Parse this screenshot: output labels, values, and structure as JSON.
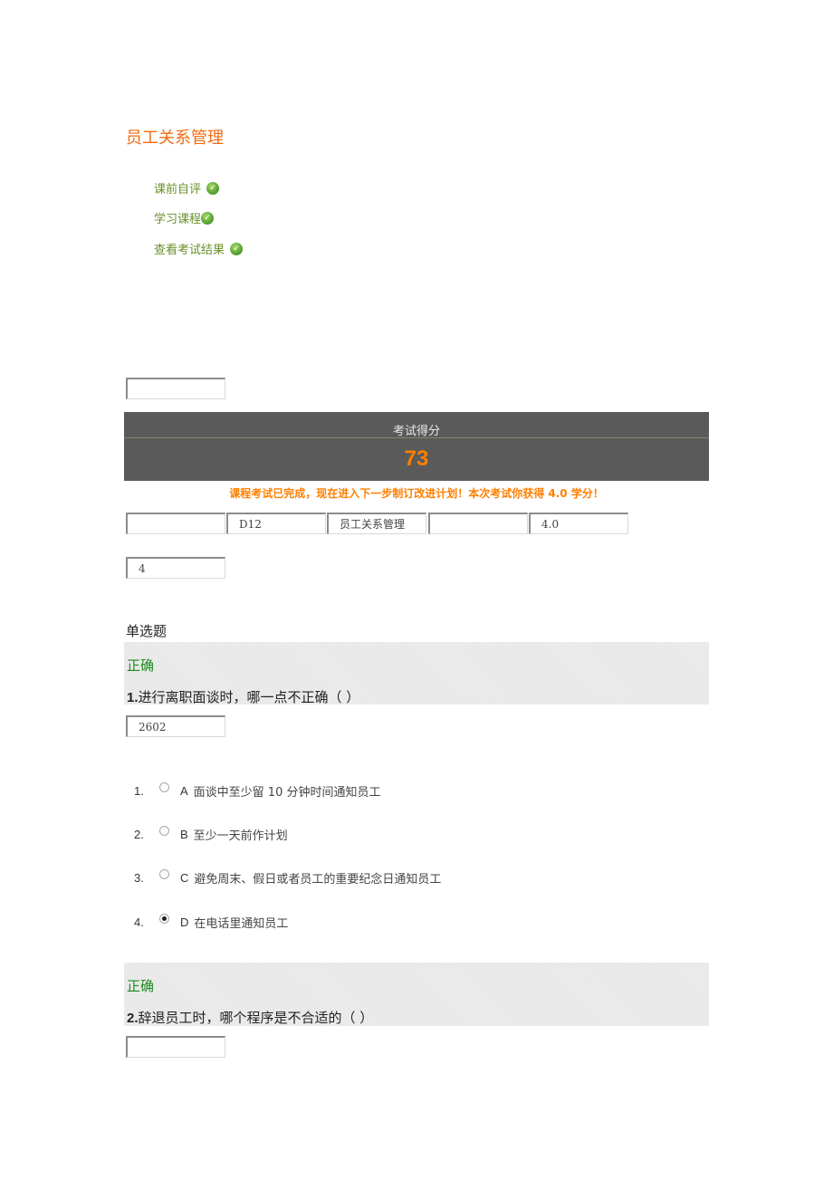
{
  "page_title": "员工关系管理",
  "nav": [
    {
      "label": "课前自评",
      "icon": "check-icon"
    },
    {
      "label": "学习课程",
      "icon": "check-icon"
    },
    {
      "label": "查看考试结果",
      "icon": "check-icon"
    }
  ],
  "top_field": {
    "value": ""
  },
  "score_panel": {
    "label": "考试得分",
    "score": "73"
  },
  "completion_message": "课程考试已完成，现在进入下一步制订改进计划！本次考试你获得 4.0 学分！",
  "info_fields": [
    "",
    "D12",
    "员工关系管理",
    "",
    "4.0"
  ],
  "count_field": {
    "value": "4"
  },
  "section_title": "单选题",
  "questions": [
    {
      "status": "正确",
      "number": "1.",
      "text": "进行离职面谈时，哪一点不正确（ ）",
      "id_field": "2602",
      "options": [
        {
          "num": "1.",
          "letter": "A",
          "text": "面谈中至少留 10 分钟时间通知员工",
          "selected": false
        },
        {
          "num": "2.",
          "letter": "B",
          "text": "至少一天前作计划",
          "selected": false
        },
        {
          "num": "3.",
          "letter": "C",
          "text": "避免周末、假日或者员工的重要纪念日通知员工",
          "selected": false
        },
        {
          "num": "4.",
          "letter": "D",
          "text": "在电话里通知员工",
          "selected": true
        }
      ]
    },
    {
      "status": "正确",
      "number": "2.",
      "text": "辞退员工时，哪个程序是不合适的（ ）",
      "id_field": ""
    }
  ],
  "colors": {
    "title": "#f26a10",
    "nav_link": "#6a8f2a",
    "score": "#ff7f00",
    "correct": "#1c8a1c",
    "panel_bg": "#5a5a5a"
  }
}
